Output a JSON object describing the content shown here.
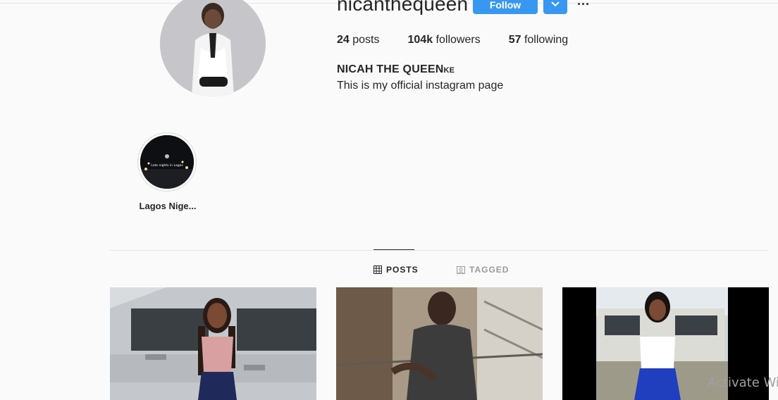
{
  "profile": {
    "username": "nicanthequeen",
    "follow_label": "Follow",
    "posts_count": "24",
    "posts_label": "posts",
    "followers_count": "104k",
    "followers_label": "followers",
    "following_count": "57",
    "following_label": "following",
    "full_name": "NICAH THE QUEEN",
    "full_name_suffix": "KE",
    "bio": "This is my official instagram page"
  },
  "highlights": [
    {
      "label": "Lagos Nige...",
      "icon": "night-road-thumbnail",
      "thumb_caption": "Late nights in Lagos"
    }
  ],
  "tabs": [
    {
      "label": "POSTS",
      "icon": "grid-icon",
      "active": true
    },
    {
      "label": "TAGGED",
      "icon": "tagged-icon",
      "active": false
    }
  ],
  "posts": [
    {
      "icon": "photo-woman-by-silver-car"
    },
    {
      "icon": "photo-woman-on-balcony"
    },
    {
      "icon": "photo-woman-by-white-suv"
    }
  ],
  "os_overlay": {
    "watermark": "Activate Wi"
  },
  "colors": {
    "accent": "#3897f0",
    "text": "#262626",
    "muted": "#999999",
    "background": "#fafafa"
  }
}
